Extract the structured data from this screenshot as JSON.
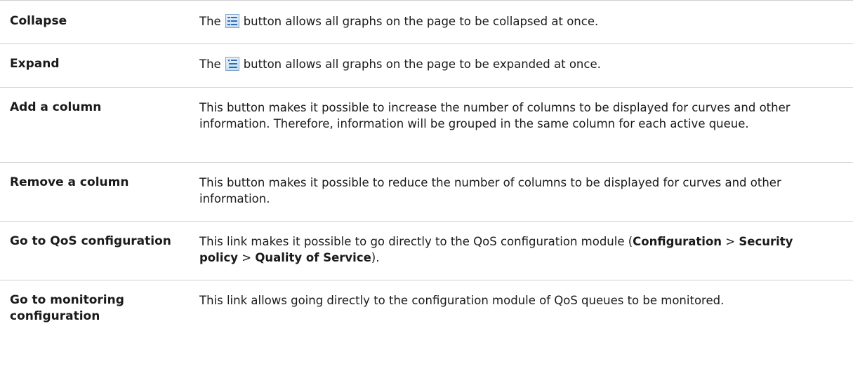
{
  "rows": [
    {
      "term": "Collapse",
      "desc_before": "The",
      "icon": "collapse-all-icon",
      "desc_after": "button allows all graphs on the page to be collapsed at once."
    },
    {
      "term": "Expand",
      "desc_before": "The",
      "icon": "expand-all-icon",
      "desc_after": "button allows all graphs on the page to be expanded at once."
    },
    {
      "term": "Add a column",
      "desc": "This button makes it possible to increase the number of columns to be displayed for curves and other information. Therefore, information will be grouped in the same column for each active queue."
    },
    {
      "term": "Remove a column",
      "desc": "This button makes it possible to reduce the number of columns to be displayed for curves and other information."
    },
    {
      "term": "Go to QoS configuration",
      "desc_part1": "This link makes it possible to go directly to the QoS configuration module (",
      "path_1": "Configuration",
      "sep_1": " > ",
      "path_2": "Security policy",
      "sep_2": " > ",
      "path_3": "Quality of Service",
      "desc_part2": ")."
    },
    {
      "term": "Go to monitoring configuration",
      "desc": "This link allows going directly to the configuration module of QoS queues to be monitored."
    }
  ],
  "colors": {
    "row_divider": "#cfcfcf",
    "icon_blue": "#2f6db5"
  }
}
